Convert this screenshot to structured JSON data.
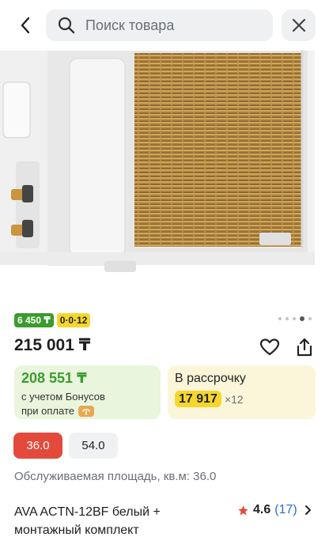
{
  "header": {
    "search_placeholder": "Поиск товара",
    "icons": {
      "back": "chevron-left-icon",
      "search": "search-icon",
      "close": "close-icon"
    }
  },
  "gallery": {
    "slide_count": 5,
    "active_slide": 4
  },
  "badges": {
    "bonus": "6 450 ₸",
    "installment": "0·0·12"
  },
  "price": "215 001 ₸",
  "bonus_card": {
    "amount": "208 551 ₸",
    "note_line1": "с учетом Бонусов",
    "note_line2": "при оплате"
  },
  "installment_card": {
    "title": "В рассрочку",
    "amount": "17 917",
    "multiplier": "×12"
  },
  "options": [
    "36.0",
    "54.0"
  ],
  "selected_option": "36.0",
  "area_label": "Обслуживаемая площадь, кв.м: 36.0",
  "product_title": "AVA ACTN-12BF белый + монтажный комплект",
  "rating": {
    "value": "4.6",
    "count": "(17)"
  },
  "colors": {
    "accent_red": "#e34a3c",
    "bonus_green": "#3c9b2e",
    "installment_yellow": "#f5d72c",
    "link_blue": "#2a6ec6"
  }
}
